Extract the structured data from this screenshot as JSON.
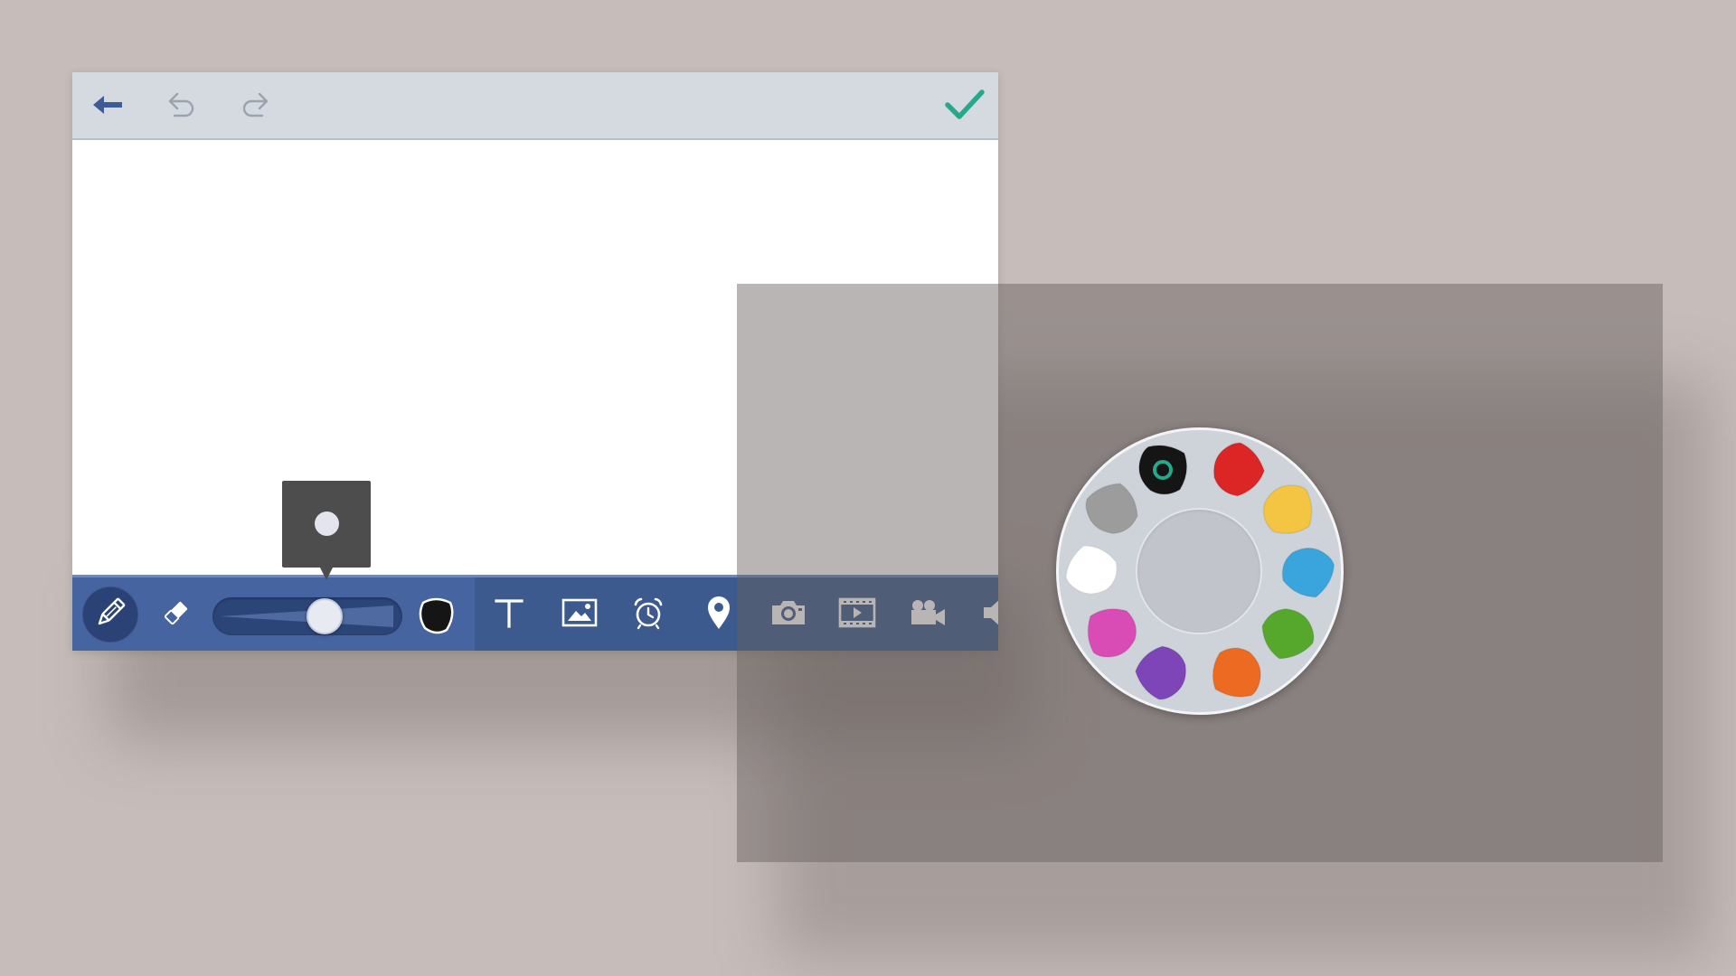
{
  "top_bar": {
    "icons": [
      "back-arrow-icon",
      "undo-icon",
      "redo-icon",
      "checkmark-icon"
    ],
    "colors": {
      "back": "#3d5c97",
      "undo_redo": "#9aa3ae",
      "confirm": "#25a98a"
    }
  },
  "bottom_toolbar": {
    "tools": [
      "pencil-icon",
      "eraser-icon",
      "brush-size-slider",
      "color-swatch-icon",
      "text-icon",
      "image-icon",
      "alarm-clock-icon",
      "location-pin-icon",
      "camera-icon",
      "video-icon",
      "movie-camera-icon",
      "speaker-icon"
    ],
    "active_tool": "pencil",
    "brush_size_level": 0.62,
    "current_color": "#151515"
  },
  "size_preview": {
    "visible": true
  },
  "palette": {
    "colors": [
      "#151515",
      "#dc2626",
      "#f4c542",
      "#3aa5dd",
      "#55a82c",
      "#ec6a22",
      "#7d45b7",
      "#d94cb5",
      "#ffffff",
      "#9c9c9c"
    ],
    "selected_index": 0,
    "selection_indicator_color": "#25a98a"
  },
  "colors": {
    "background": "#c6bcba",
    "toolbar": "#3c5a8d",
    "toolbar_active_group": "#4564a0",
    "top_bar": "#d5dae1"
  }
}
